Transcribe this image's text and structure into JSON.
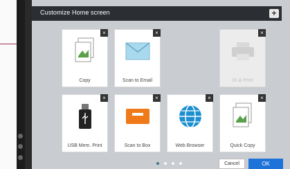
{
  "header": {
    "title": "Customize Home screen",
    "add_label": "+"
  },
  "tiles": [
    {
      "label": "Copy",
      "close": "×"
    },
    {
      "label": "Scan to Email",
      "close": "×"
    },
    {
      "label": "ID & Print",
      "close": "×"
    },
    {
      "label": "USB Mem. Print",
      "close": "×"
    },
    {
      "label": "Scan to Box",
      "close": "×"
    },
    {
      "label": "Web Browser",
      "close": "×"
    },
    {
      "label": "Quick Copy",
      "close": "×"
    }
  ],
  "footer": {
    "cancel_label": "Cancel",
    "ok_label": "OK"
  },
  "pagination": {
    "pages": 4,
    "current": 1
  },
  "colors": {
    "header": "#2b2f34",
    "ok": "#1e73d8",
    "accent": "#9a3050"
  }
}
